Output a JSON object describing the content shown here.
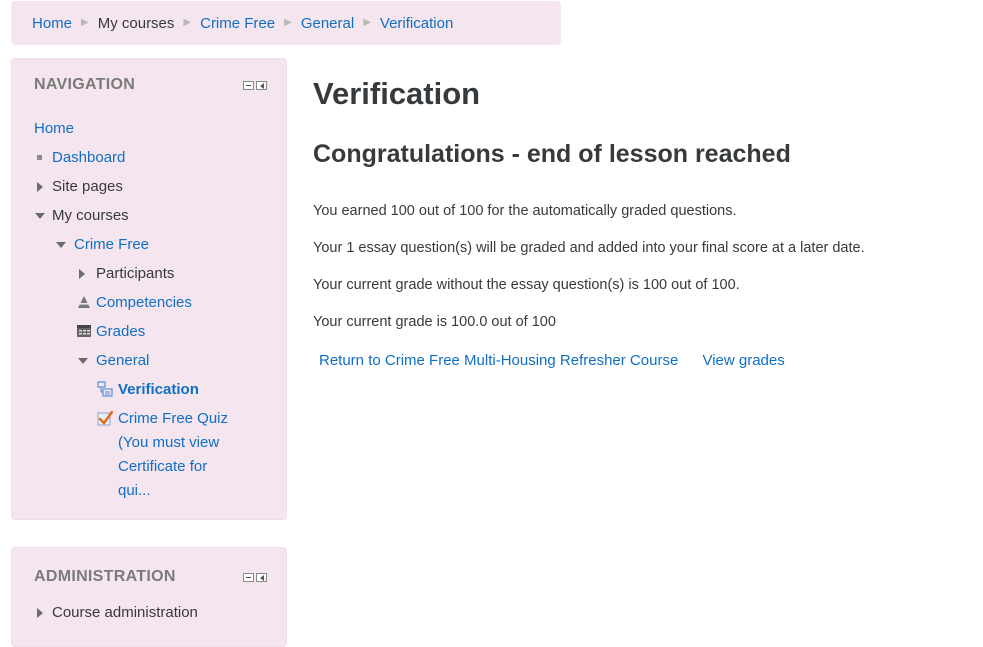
{
  "breadcrumb": {
    "items": [
      "Home",
      "My courses",
      "Crime Free",
      "General",
      "Verification"
    ]
  },
  "navigation": {
    "title": "NAVIGATION",
    "home": "Home",
    "dashboard": "Dashboard",
    "site_pages": "Site pages",
    "my_courses": "My courses",
    "crime_free": "Crime Free",
    "participants": "Participants",
    "competencies": "Competencies",
    "grades": "Grades",
    "general": "General",
    "verification": "Verification",
    "quiz_lines": [
      "Crime Free Quiz",
      "(You must view",
      "Certificate for",
      "qui..."
    ]
  },
  "administration": {
    "title": "ADMINISTRATION",
    "course_admin": "Course administration"
  },
  "main": {
    "title": "Verification",
    "subtitle": "Congratulations - end of lesson reached",
    "messages": [
      "You earned 100 out of 100 for the automatically graded questions.",
      "Your 1 essay question(s) will be graded and added into your final score at a later date.",
      "Your current grade without the essay question(s) is 100 out of 100.",
      "Your current grade is 100.0 out of 100"
    ],
    "return_link": "Return to Crime Free Multi-Housing Refresher Course",
    "grades_link": "View grades"
  },
  "colors": {
    "link": "#0f6fc5",
    "block_bg": "#f5e5ef",
    "text": "#373a3c"
  },
  "icons": {
    "competencies": "competencies-icon",
    "grades": "grades-table-icon",
    "verification": "lesson-icon",
    "quiz": "quiz-checkmark-icon"
  }
}
